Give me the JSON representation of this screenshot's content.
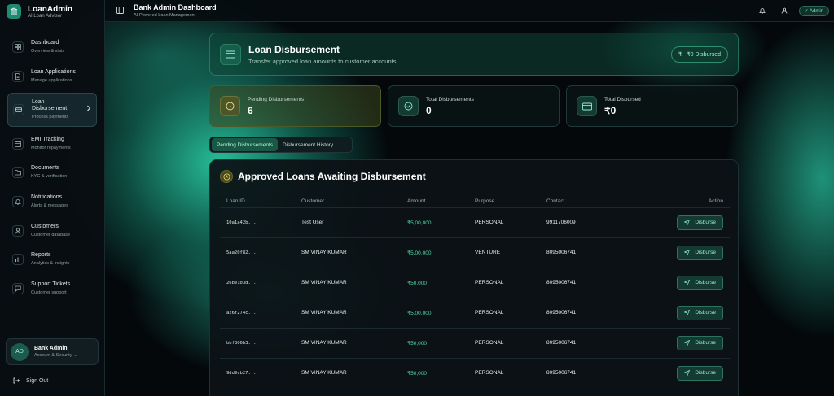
{
  "sidebar": {
    "brand_title": "LoanAdmin",
    "brand_sub": "AI Loan Advisor",
    "items": [
      {
        "label": "Dashboard",
        "sub": "Overview & stats",
        "icon": "grid-icon"
      },
      {
        "label": "Loan Applications",
        "sub": "Manage applications",
        "icon": "file-icon"
      },
      {
        "label": "Loan Disbursement",
        "sub": "Process payments",
        "icon": "card-icon",
        "active": true
      },
      {
        "label": "EMI Tracking",
        "sub": "Monitor repayments",
        "icon": "calendar-icon"
      },
      {
        "label": "Documents",
        "sub": "KYC & verification",
        "icon": "folder-icon"
      },
      {
        "label": "Notifications",
        "sub": "Alerts & messages",
        "icon": "bell-icon"
      },
      {
        "label": "Customers",
        "sub": "Customer database",
        "icon": "users-icon"
      },
      {
        "label": "Reports",
        "sub": "Analytics & insights",
        "icon": "chart-icon"
      },
      {
        "label": "Support Tickets",
        "sub": "Customer support",
        "icon": "message-icon"
      }
    ],
    "account": {
      "initials": "AD",
      "name": "Bank Admin",
      "sub": "Account & Security →"
    },
    "signout": "Sign Out"
  },
  "header": {
    "title": "Bank Admin Dashboard",
    "sub": "AI-Powered Loan Management",
    "admin_badge": "✓ Admin"
  },
  "banner": {
    "title": "Loan Disbursement",
    "sub": "Transfer approved loan amounts to customer accounts",
    "badge_symbol": "₹",
    "badge": "₹0 Disbursed"
  },
  "stats": [
    {
      "label": "Pending Disbursements",
      "value": "6"
    },
    {
      "label": "Total Disbursements",
      "value": "0"
    },
    {
      "label": "Total Disbursed",
      "value": "₹0"
    }
  ],
  "tabs": {
    "pending": "Pending Disbursements",
    "history": "Disbursement History"
  },
  "panel": {
    "title": "Approved Loans Awaiting Disbursement",
    "columns": {
      "id": "Loan ID",
      "customer": "Customer",
      "amount": "Amount",
      "purpose": "Purpose",
      "contact": "Contact",
      "action": "Action"
    },
    "rows": [
      {
        "id": "10a1a42b...",
        "customer": "Test User",
        "amount": "₹5,00,000",
        "purpose": "PERSONAL",
        "contact": "9911706009",
        "action": "Disburse"
      },
      {
        "id": "5aa20f82...",
        "customer": "SM VINAY KUMAR",
        "amount": "₹5,00,000",
        "purpose": "VENTURE",
        "contact": "8095006741",
        "action": "Disburse"
      },
      {
        "id": "26be103d...",
        "customer": "SM VINAY KUMAR",
        "amount": "₹50,000",
        "purpose": "PERSONAL",
        "contact": "8095006741",
        "action": "Disburse"
      },
      {
        "id": "a26f274c...",
        "customer": "SM VINAY KUMAR",
        "amount": "₹5,00,000",
        "purpose": "PERSONAL",
        "contact": "8095006741",
        "action": "Disburse"
      },
      {
        "id": "bbf806b3...",
        "customer": "SM VINAY KUMAR",
        "amount": "₹50,000",
        "purpose": "PERSONAL",
        "contact": "8095006741",
        "action": "Disburse"
      },
      {
        "id": "9dd9cb27...",
        "customer": "SM VINAY KUMAR",
        "amount": "₹50,000",
        "purpose": "PERSONAL",
        "contact": "8095006741",
        "action": "Disburse"
      }
    ]
  },
  "colors": {
    "accent": "#55d6a3",
    "brand": "#1f8a72",
    "background": "#04080b"
  }
}
